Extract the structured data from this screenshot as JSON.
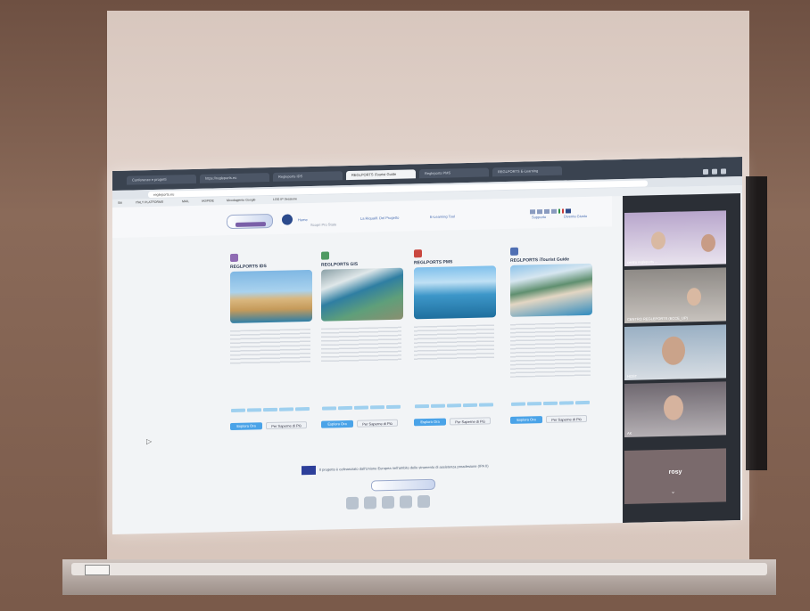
{
  "browser": {
    "tabs": [
      "Conferenze e progetti",
      "https://regleports.eu",
      "Regleports IDS",
      "REGLPORTS iTourist Guide",
      "Regleports PMS",
      "REGLPORTS E-Learning"
    ],
    "address": "regleports.eu",
    "bookmarks": [
      "Siti",
      "ITALY PLATFORMS",
      "MAIL",
      "IASPIDE",
      "Moodapjento Google",
      "LOG IP Sessione"
    ]
  },
  "site": {
    "nav": [
      "Home",
      "Scopri Pro Stato",
      "La Riqualif. Del Progetto",
      "E-Learning Tool"
    ],
    "header_right": [
      "Supporto",
      "Diventa Giusto"
    ],
    "eu_text": "Il progetto è cofinanziato dall'Unione Europea nell'ambito dello strumento di assistenza preadesione (IPA II)",
    "cards": [
      {
        "title": "REGLPORTS IDS",
        "icon_color": "#8f6bb3",
        "explore": "Esplora Ora",
        "more": "Per Saperne di Più"
      },
      {
        "title": "REGLPORTS GIS",
        "icon_color": "#4f9a62",
        "explore": "Esplora Ora",
        "more": "Per Saperne di Più"
      },
      {
        "title": "REGLPORTS PMS",
        "icon_color": "#c9473f",
        "explore": "Esplora Ora",
        "more": "Per Saperne di Più"
      },
      {
        "title": "REGLPORTS iTourist Guide",
        "icon_color": "#4f6fb3",
        "explore": "Esplora Ora",
        "more": "Per Saperne di Più"
      }
    ]
  },
  "call": {
    "participants": [
      "centro regleports ...",
      "CENTRO REGLEPORTS (ECCE_UP)",
      "HOST",
      "AK"
    ],
    "active_name": "rosy"
  }
}
